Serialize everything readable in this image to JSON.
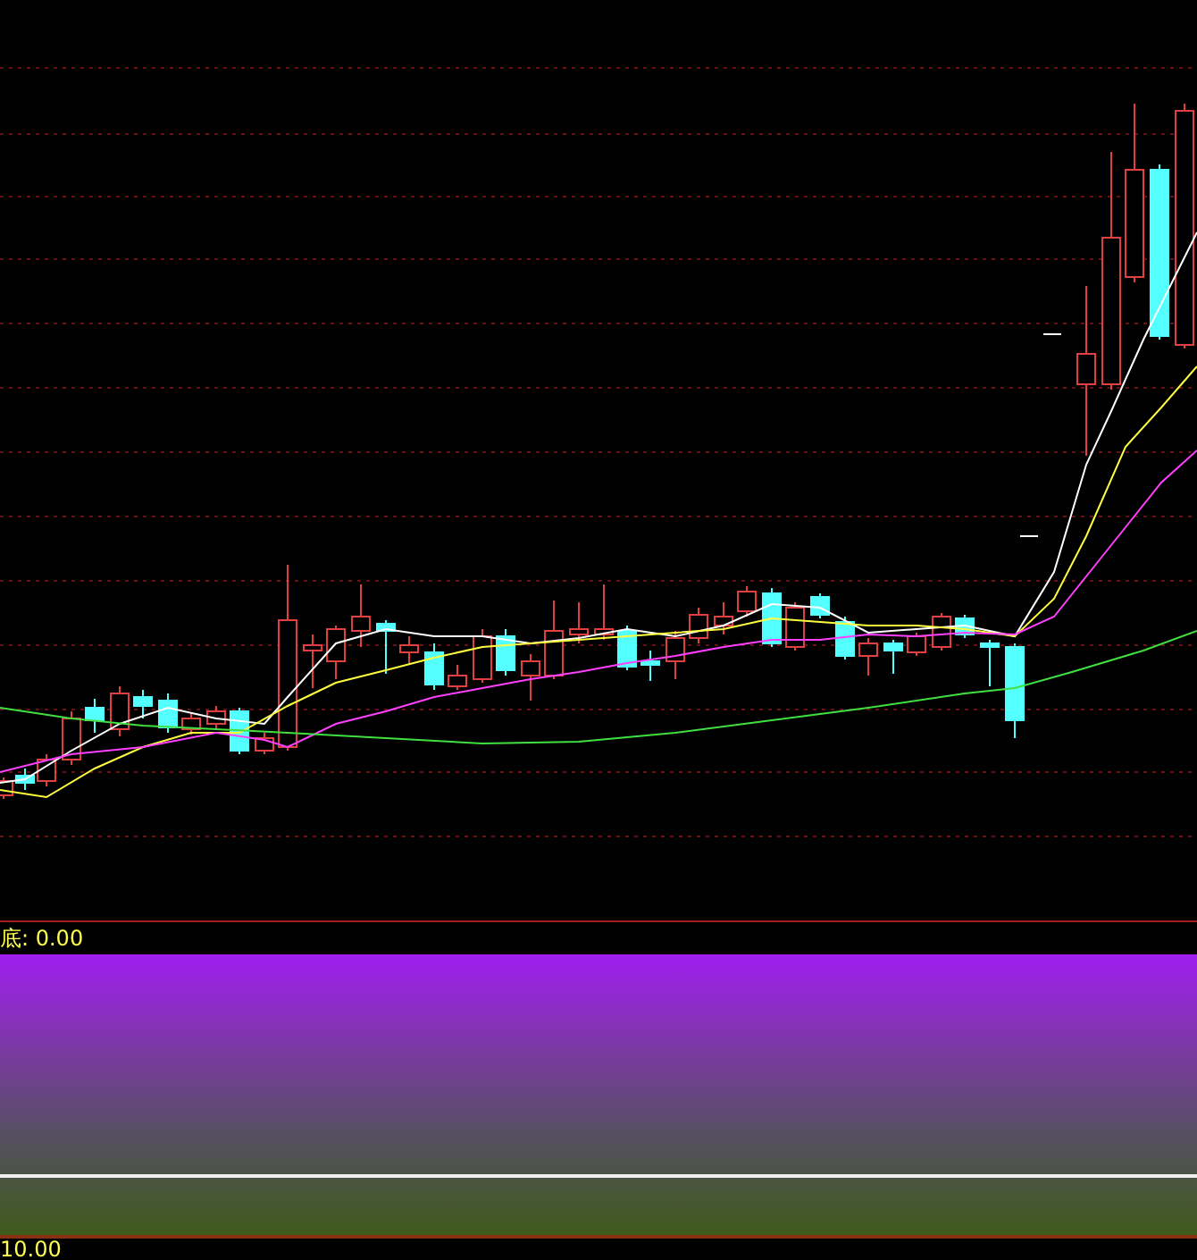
{
  "indicator_panel": {
    "label": "底: 0.00"
  },
  "lower_axis": {
    "label": "10.00"
  }
}
